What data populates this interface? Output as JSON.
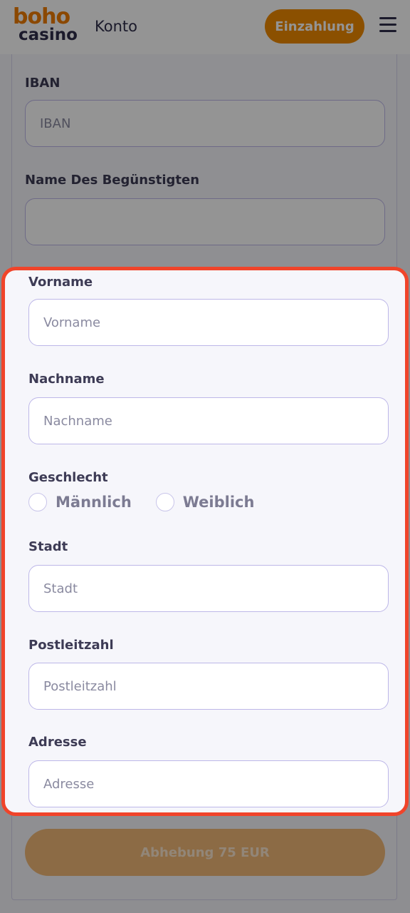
{
  "header": {
    "logo_top": "boho",
    "logo_bottom": "casino",
    "title": "Konto",
    "deposit_label": "Einzahlung",
    "menu_icon": "hamburger-menu-icon"
  },
  "form": {
    "iban": {
      "label": "IBAN",
      "placeholder": "IBAN",
      "value": ""
    },
    "beneficiary": {
      "label": "Name Des Begünstigten",
      "placeholder": "",
      "value": ""
    },
    "first_name": {
      "label": "Vorname",
      "placeholder": "Vorname",
      "value": ""
    },
    "last_name": {
      "label": "Nachname",
      "placeholder": "Nachname",
      "value": ""
    },
    "gender": {
      "label": "Geschlecht",
      "options": [
        "Männlich",
        "Weiblich"
      ],
      "selected": null
    },
    "city": {
      "label": "Stadt",
      "placeholder": "Stadt",
      "value": ""
    },
    "postal_code": {
      "label": "Postleitzahl",
      "placeholder": "Postleitzahl",
      "value": ""
    },
    "address": {
      "label": "Adresse",
      "placeholder": "Adresse",
      "value": ""
    },
    "submit_label": "Abhebung 75 EUR"
  },
  "colors": {
    "brand_orange": "#f08a00",
    "highlight_border": "#f0442a",
    "input_border": "#bdb7e8"
  }
}
